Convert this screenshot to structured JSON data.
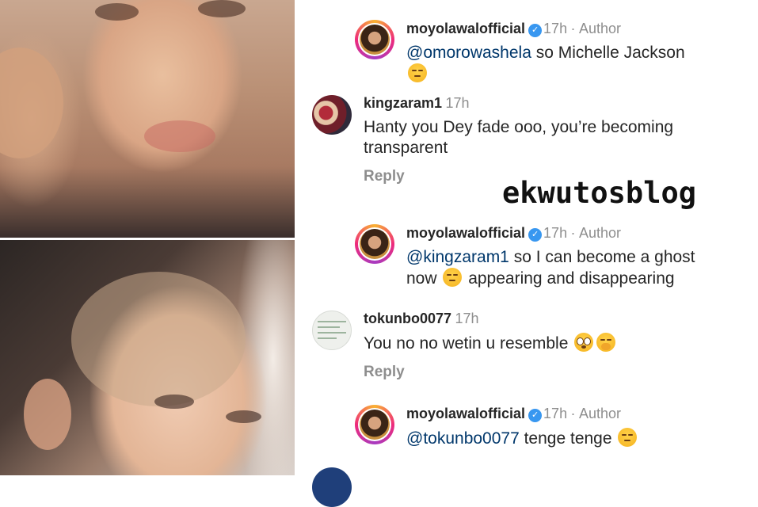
{
  "photos": {
    "top_alt": "selfie-with-full-hair",
    "bottom_alt": "selfie-with-shaved-head"
  },
  "comments": [
    {
      "username": "moyolawalofficial",
      "verified": true,
      "time": "17h",
      "separator": "·",
      "badge": "Author",
      "mention": "@omorowashela",
      "text": " so Michelle Jackson",
      "emoji": "unamused-face"
    },
    {
      "username": "kingzaram1",
      "time": "17h",
      "text_line1": "Hanty you Dey fade ooo, you’re becoming",
      "text_line2": "transparent",
      "reply_label": "Reply"
    },
    {
      "username": "moyolawalofficial",
      "verified": true,
      "time": "17h",
      "separator": "·",
      "badge": "Author",
      "mention": "@kingzaram1",
      "text_line1": " so I can become a ghost",
      "text_line2_before": "now ",
      "emoji": "unamused-face",
      "text_line2_after": " appearing and disappearing"
    },
    {
      "username": "tokunbo0077",
      "time": "17h",
      "text": "You no no wetin u resemble ",
      "emojis": [
        "flushed-face",
        "face-with-hand-over-mouth"
      ],
      "reply_label": "Reply"
    },
    {
      "username": "moyolawalofficial",
      "verified": true,
      "time": "17h",
      "separator": "·",
      "badge": "Author",
      "mention": "@tokunbo0077",
      "text": " tenge tenge ",
      "emoji": "unamused-face"
    }
  ],
  "watermark": "ekwutosblog",
  "colors": {
    "mention": "#00376b",
    "meta_gray": "#8e8e8e",
    "verified_blue": "#3897f0"
  }
}
